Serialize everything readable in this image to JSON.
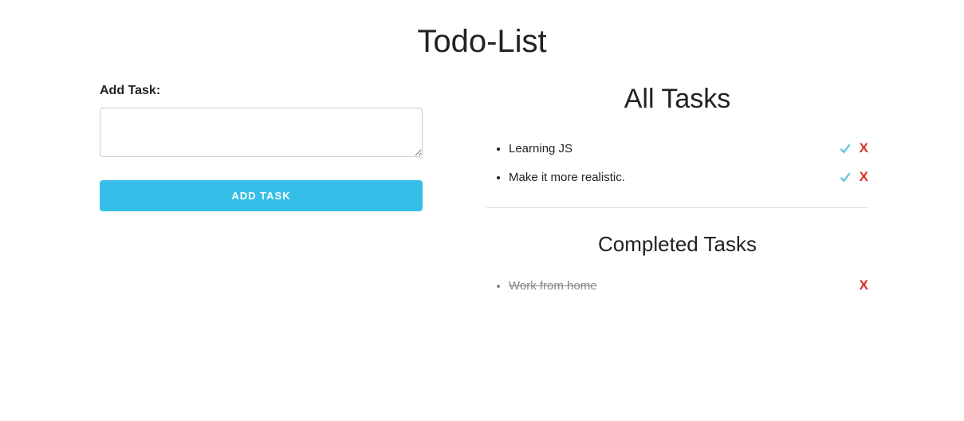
{
  "page_title": "Todo-List",
  "form": {
    "label": "Add Task:",
    "input_value": "",
    "button_label": "ADD TASK"
  },
  "all_tasks": {
    "heading": "All Tasks",
    "items": [
      {
        "text": "Learning JS"
      },
      {
        "text": "Make it more realistic."
      }
    ]
  },
  "completed_tasks": {
    "heading": "Completed Tasks",
    "items": [
      {
        "text": "Work from home"
      }
    ]
  },
  "icons": {
    "delete_label": "X"
  }
}
